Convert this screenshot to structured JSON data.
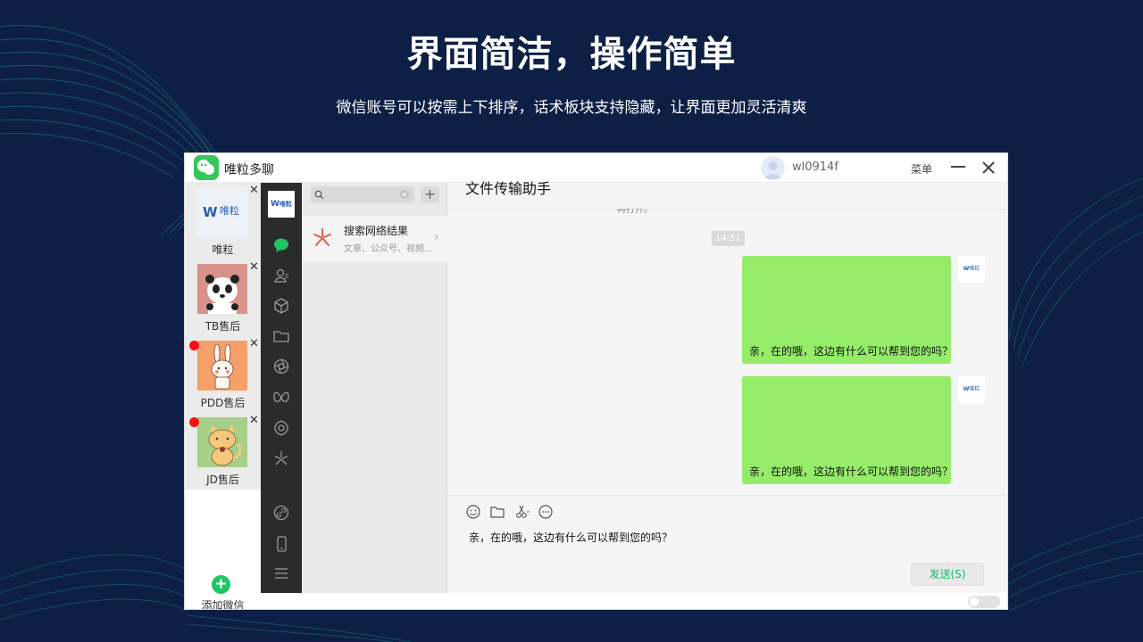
{
  "hero": {
    "title": "界面简洁，操作简单",
    "subtitle": "微信账号可以按需上下排序，话术板块支持隐藏，让界面更加灵活清爽"
  },
  "colors": {
    "background": "#0d1f44",
    "accent_green": "#07c160",
    "bubble_green": "#95ec69",
    "unread_red": "#f21212"
  },
  "window": {
    "app_name": "唯粒多聊",
    "user_name": "wl0914f",
    "menu_label": "菜单",
    "minimize_icon": "minus-icon",
    "close_icon": "close-icon"
  },
  "accounts": [
    {
      "label": "唯粒",
      "logo_text": "唯粒",
      "unread": false
    },
    {
      "label": "TB售后",
      "unread": false
    },
    {
      "label": "PDD售后",
      "unread": true
    },
    {
      "label": "JD售后",
      "unread": true
    }
  ],
  "add_account": {
    "label": "添加微信"
  },
  "nav": {
    "logo_text": "唯粒",
    "icons": [
      "chat-icon",
      "contacts-icon",
      "cube-icon",
      "folder-icon",
      "aperture-icon",
      "butterfly-icon",
      "settings-icon",
      "sparkle-icon",
      "link-icon",
      "phone-icon",
      "menu-icon"
    ]
  },
  "convlist": {
    "search_placeholder": "",
    "result_title": "搜索网络结果",
    "result_sub": "文章、公众号、视频..."
  },
  "chat": {
    "title": "文件传输助手",
    "prev_message_fragment": "再打开。",
    "timestamp": "14:51",
    "messages": [
      {
        "text": "亲，在的哦，这边有什么可以帮到您的吗？",
        "avatar_text": "唯粒"
      },
      {
        "text": "亲，在的哦，这边有什么可以帮到您的吗？",
        "avatar_text": "唯粒"
      }
    ],
    "toolbar_icons": [
      "emoji-icon",
      "folder-icon",
      "scissors-icon",
      "chat-bubble-icon"
    ],
    "draft": "亲，在的哦，这边有什么可以帮到您的吗？",
    "send_label": "发送(S)"
  }
}
